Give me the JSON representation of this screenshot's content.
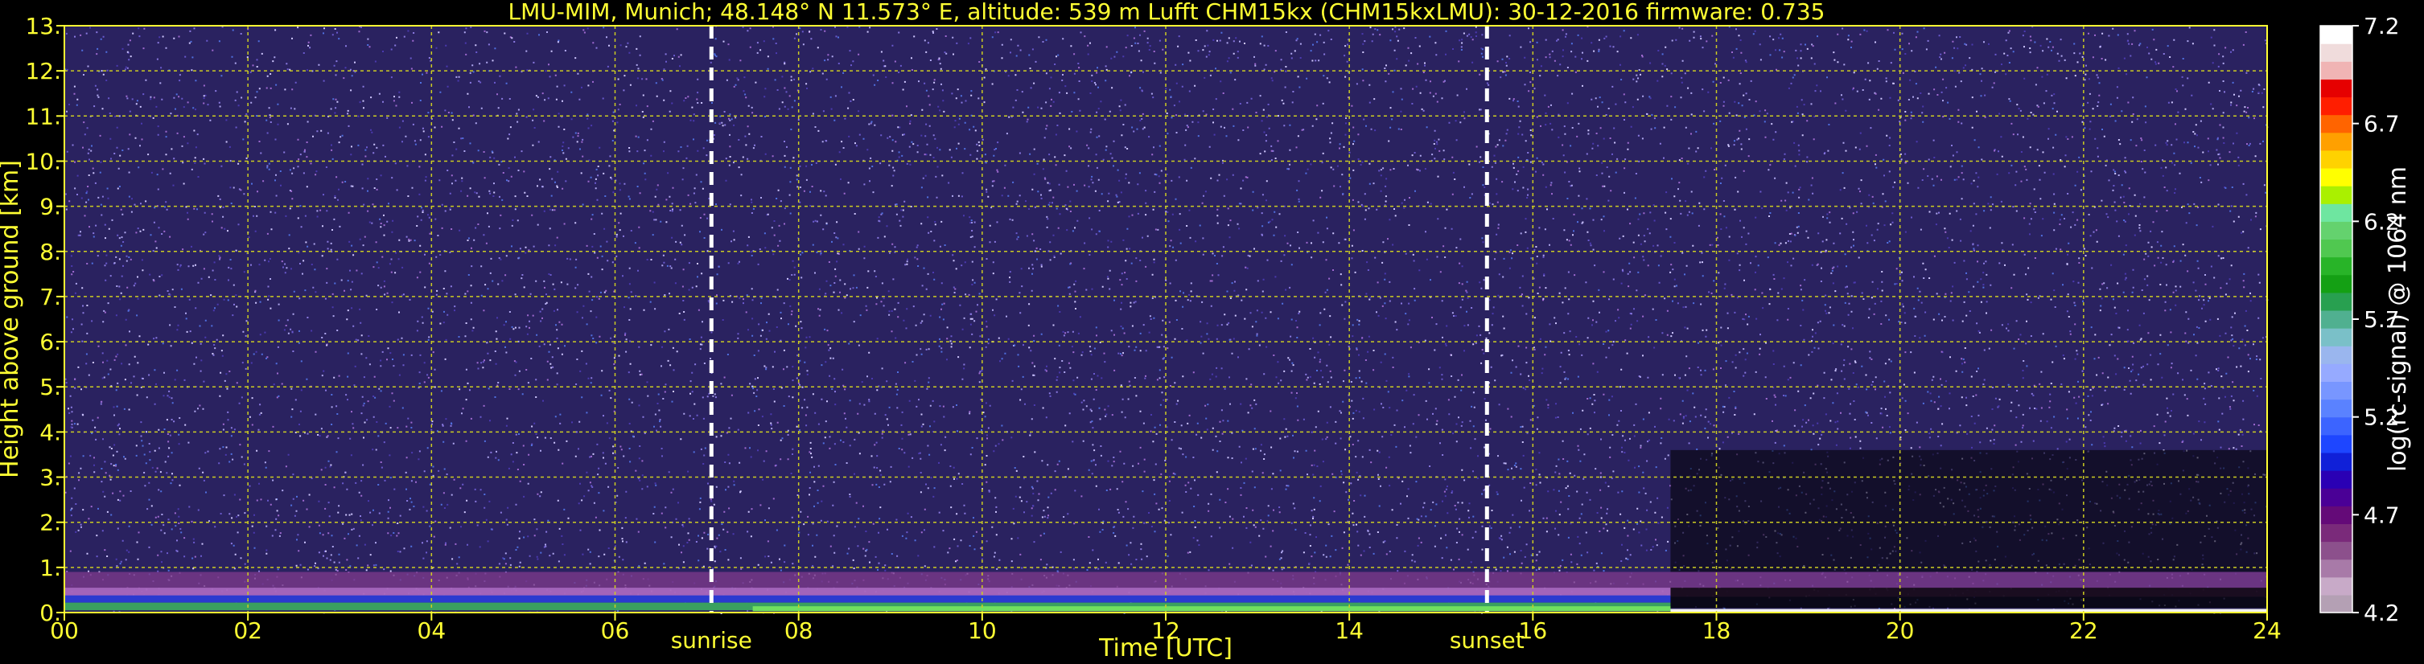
{
  "title": "LMU-MIM, Munich; 48.148° N 11.573° E, altitude: 539 m    Lufft CHM15kx (CHM15kxLMU): 30-12-2016    firmware: 0.735",
  "colorbar_label": "log(rc-signal) @ 1064 nm",
  "colors": {
    "text": "#ffff33",
    "grid": "#cccc22",
    "background": "#000000",
    "noise_base": "#2a2260"
  },
  "chart_data": {
    "type": "heatmap",
    "title": "LMU-MIM, Munich; 48.148° N 11.573° E, altitude: 539 m    Lufft CHM15kx (CHM15kxLMU): 30-12-2016    firmware: 0.735",
    "xlabel": "Time [UTC]",
    "ylabel": "Height above ground [km]",
    "xlim": [
      0,
      24
    ],
    "ylim": [
      0,
      13
    ],
    "x_ticks": [
      "00",
      "02",
      "04",
      "06",
      "08",
      "10",
      "12",
      "14",
      "16",
      "18",
      "20",
      "22",
      "24"
    ],
    "x_tick_values": [
      0,
      2,
      4,
      6,
      8,
      10,
      12,
      14,
      16,
      18,
      20,
      22,
      24
    ],
    "y_ticks": [
      "0.",
      "1.",
      "2.",
      "3.",
      "4.",
      "5.",
      "6.",
      "7.",
      "8.",
      "9.",
      "10.",
      "11.",
      "12.",
      "13."
    ],
    "y_tick_values": [
      0,
      1,
      2,
      3,
      4,
      5,
      6,
      7,
      8,
      9,
      10,
      11,
      12,
      13
    ],
    "grid": true,
    "markers": [
      {
        "label": "sunrise",
        "time": 7.05
      },
      {
        "label": "sunset",
        "time": 15.5
      }
    ],
    "colorbar": {
      "label": "log(rc-signal) @ 1064 nm",
      "range": [
        4.2,
        7.2
      ],
      "ticks": [
        "4.2",
        "4.7",
        "5.2",
        "5.7",
        "6.2",
        "6.7",
        "7.2"
      ],
      "tick_values": [
        4.2,
        4.7,
        5.2,
        5.7,
        6.2,
        6.7,
        7.2
      ],
      "colors": [
        "#b4a0b4",
        "#c8aac8",
        "#a87aa8",
        "#8c508c",
        "#7a2a7a",
        "#640a78",
        "#4a0096",
        "#2a00b4",
        "#1020d8",
        "#1e46ff",
        "#3c64ff",
        "#5a82ff",
        "#7896ff",
        "#96aaff",
        "#9ab6ee",
        "#7ac0c8",
        "#50b090",
        "#28a050",
        "#14a014",
        "#28b428",
        "#50c850",
        "#64d26e",
        "#6ee6a0",
        "#aaf000",
        "#ffff00",
        "#ffd200",
        "#ffa000",
        "#ff6400",
        "#ff1e00",
        "#e60000",
        "#f0b4b4",
        "#f0dcdc",
        "#ffffff"
      ]
    },
    "features": [
      {
        "name": "boundary layer aerosol (green/blue)",
        "t_start": 0,
        "t_end": 17.5,
        "h_bottom": 0.0,
        "h_top": 0.35
      },
      {
        "name": "residual layer (magenta)",
        "t_start": 0,
        "t_end": 24,
        "h_bottom": 0.35,
        "h_top": 0.9
      },
      {
        "name": "low cloud",
        "t_start": 17.5,
        "t_end": 24,
        "h_bottom": 0.0,
        "h_top": 0.1
      }
    ]
  }
}
